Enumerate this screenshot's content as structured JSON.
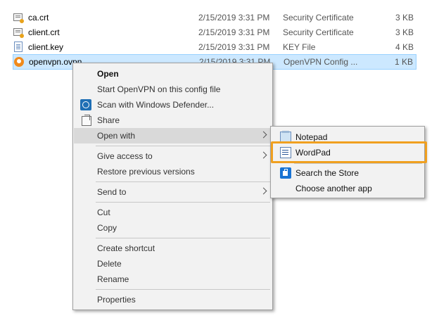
{
  "files": [
    {
      "name": "ca.crt",
      "date": "2/15/2019 3:31 PM",
      "type": "Security Certificate",
      "size": "3 KB",
      "icon": "certificate-icon"
    },
    {
      "name": "client.crt",
      "date": "2/15/2019 3:31 PM",
      "type": "Security Certificate",
      "size": "3 KB",
      "icon": "certificate-icon"
    },
    {
      "name": "client.key",
      "date": "2/15/2019 3:31 PM",
      "type": "KEY File",
      "size": "4 KB",
      "icon": "file-icon"
    },
    {
      "name": "openvpn.ovpn",
      "date": "2/15/2019 3:31 PM",
      "type": "OpenVPN Config ...",
      "size": "1 KB",
      "icon": "openvpn-icon",
      "selected": true
    }
  ],
  "context_menu": {
    "open": "Open",
    "start_openvpn": "Start OpenVPN on this config file",
    "scan_defender": "Scan with Windows Defender...",
    "share": "Share",
    "open_with": "Open with",
    "give_access": "Give access to",
    "restore_versions": "Restore previous versions",
    "send_to": "Send to",
    "cut": "Cut",
    "copy": "Copy",
    "create_shortcut": "Create shortcut",
    "delete": "Delete",
    "rename": "Rename",
    "properties": "Properties"
  },
  "open_with_submenu": {
    "notepad": "Notepad",
    "wordpad": "WordPad",
    "search_store": "Search the Store",
    "choose_app": "Choose another app"
  },
  "colors": {
    "selection": "#cce8ff",
    "highlight_outline": "#f0a020",
    "menu_background": "#f2f2f2"
  }
}
